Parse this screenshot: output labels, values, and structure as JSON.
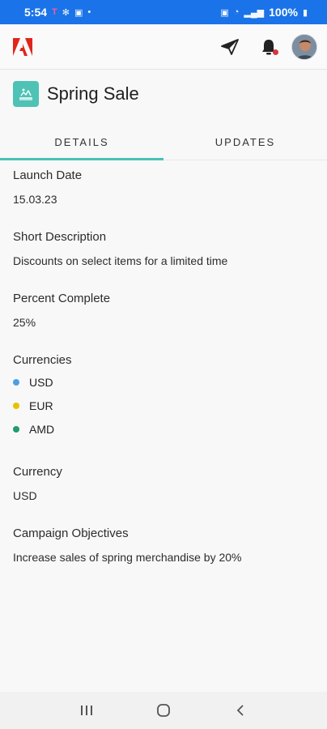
{
  "status_bar": {
    "time": "5:54",
    "battery": "100%",
    "indicator_icons": [
      "t-mobile-icon",
      "settings-icon",
      "teams-icon",
      "dot-icon"
    ]
  },
  "app": {
    "brand_color": "#e1251b",
    "accent_color": "#49c1b6"
  },
  "project": {
    "title": "Spring Sale"
  },
  "tabs": [
    {
      "label": "DETAILS",
      "active": true
    },
    {
      "label": "UPDATES",
      "active": false
    }
  ],
  "details": {
    "launch_date": {
      "label": "Launch Date",
      "value": "15.03.23"
    },
    "short_description": {
      "label": "Short Description",
      "value": "Discounts on select items for a limited time"
    },
    "percent_complete": {
      "label": "Percent Complete",
      "value": "25%"
    },
    "currencies": {
      "label": "Currencies",
      "items": [
        {
          "name": "USD",
          "color": "#4a9fe8"
        },
        {
          "name": "EUR",
          "color": "#e6c200"
        },
        {
          "name": "AMD",
          "color": "#1d9e6b"
        }
      ]
    },
    "currency": {
      "label": "Currency",
      "value": "USD"
    },
    "campaign_objectives": {
      "label": "Campaign Objectives",
      "value": "Increase sales of spring merchandise by 20%"
    }
  }
}
